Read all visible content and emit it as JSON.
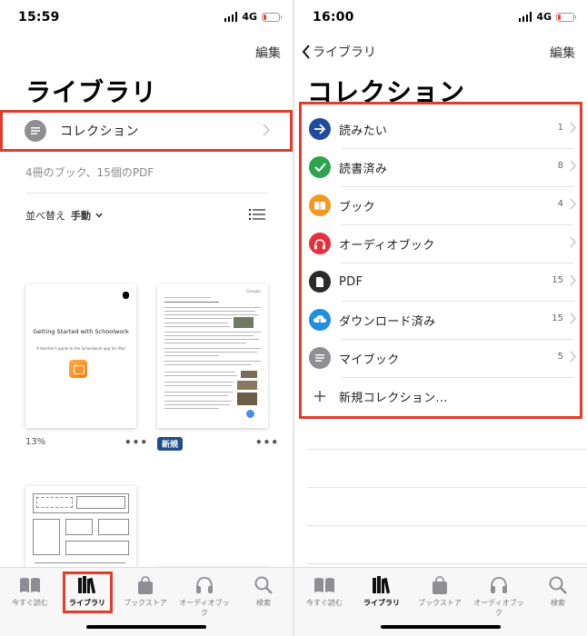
{
  "left": {
    "status": {
      "time": "15:59",
      "carrier": "4G"
    },
    "nav": {
      "edit": "編集"
    },
    "title": "ライブラリ",
    "collections_row": {
      "label": "コレクション"
    },
    "count_text": "4冊のブック、15個のPDF",
    "sort": {
      "label": "並べ替え",
      "value": "手動"
    },
    "books": [
      {
        "title": "Getting Started with Schoolwork",
        "subtitle": "A teacher's guide to the Schoolwork app for iPad",
        "progress": "13%"
      },
      {
        "header": "Google",
        "badge": "新規"
      },
      {
        "title": ""
      }
    ]
  },
  "right": {
    "status": {
      "time": "16:00",
      "carrier": "4G"
    },
    "nav": {
      "back": "ライブラリ",
      "edit": "編集"
    },
    "title": "コレクション",
    "items": [
      {
        "name": "読みたい",
        "count": "1",
        "icon": "arrow-right-icon",
        "color": "#1f4d9b"
      },
      {
        "name": "読書済み",
        "count": "8",
        "icon": "checkmark-icon",
        "color": "#2fa44f"
      },
      {
        "name": "ブック",
        "count": "4",
        "icon": "open-book-icon",
        "color": "#f39a1e"
      },
      {
        "name": "オーディオブック",
        "count": "",
        "icon": "headphones-icon",
        "color": "#e8303c"
      },
      {
        "name": "PDF",
        "count": "15",
        "icon": "document-icon",
        "color": "#2b2b2b"
      },
      {
        "name": "ダウンロード済み",
        "count": "15",
        "icon": "cloud-download-icon",
        "color": "#1e8fe1"
      },
      {
        "name": "マイブック",
        "count": "5",
        "icon": "list-icon",
        "color": "#8e8e93"
      }
    ],
    "new_collection": "新規コレクション..."
  },
  "tabbar": {
    "left_items": [
      "今すぐ読む",
      "ライブラリ",
      "ブックストア",
      "オーディオブック",
      "検索"
    ],
    "right_items": [
      "今すぐ読む",
      "ライブラリ",
      "ブックストア",
      "オーディオブック",
      "検索"
    ],
    "active": "ライブラリ"
  },
  "colors": {
    "highlight": "#e63a2a",
    "badge": "#1f4d8c",
    "battery_low": "#ff3b30"
  }
}
